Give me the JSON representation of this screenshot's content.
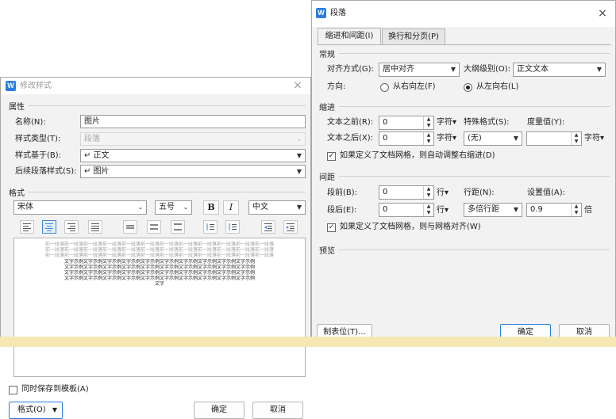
{
  "modify_style": {
    "title": "修改样式",
    "attributes_label": "属性",
    "name_label": "名称(N):",
    "name_value": "图片",
    "style_type_label": "样式类型(T):",
    "style_type_value": "段落",
    "based_on_label": "样式基于(B):",
    "based_on_value": "↵ 正文",
    "follow_label": "后续段落样式(S):",
    "follow_value": "↵ 图片",
    "format_label": "格式",
    "font_value": "宋体",
    "size_value": "五号",
    "bold_label": "B",
    "italic_label": "I",
    "lang_value": "中文",
    "preview_gray_text": "前一段落前一段落前一段落前一段落前一段落前一段落前一段落前一段落前一段落前一段落前一段落前一段落",
    "preview_dark_text": "文字示例文字示例文字示例文字示例文字示例文字示例文字示例文字示例文字示例文字示例",
    "preview_last": "文字",
    "save_template_label": "同时保存到模板(A)",
    "format_button": "格式(O)",
    "ok_button": "确定",
    "cancel_button": "取消"
  },
  "paragraph": {
    "title": "段落",
    "tabs": [
      "缩进和间距(I)",
      "换行和分页(P)"
    ],
    "general_label": "常规",
    "align_label": "对齐方式(G):",
    "align_value": "居中对齐",
    "outline_label": "大纲级别(O):",
    "outline_value": "正文文本",
    "direction_label": "方向:",
    "rtl_label": "从右向左(F)",
    "ltr_label": "从左向右(L)",
    "indent_label": "缩进",
    "before_text_label": "文本之前(R):",
    "before_text_value": "0",
    "after_text_label": "文本之后(X):",
    "after_text_value": "0",
    "char_unit": "字符▾",
    "special_label": "特殊格式(S):",
    "special_value": "(无)",
    "measure_label": "度量值(Y):",
    "measure_value": "",
    "auto_indent_label": "如果定义了文档网格，则自动调整右缩进(D)",
    "spacing_label": "间距",
    "space_before_label": "段前(B):",
    "space_before_value": "0",
    "space_after_label": "段后(E):",
    "space_after_value": "0",
    "line_unit": "行▾",
    "line_spacing_label": "行距(N):",
    "line_spacing_value": "多倍行距",
    "setting_label": "设置值(A):",
    "setting_value": "0.9",
    "times_unit": "倍",
    "snap_grid_label": "如果定义了文档网格，则与网格对齐(W)",
    "preview_label": "预览",
    "tabs_button": "制表位(T)...",
    "ok_button": "确定",
    "cancel_button": "取消"
  }
}
